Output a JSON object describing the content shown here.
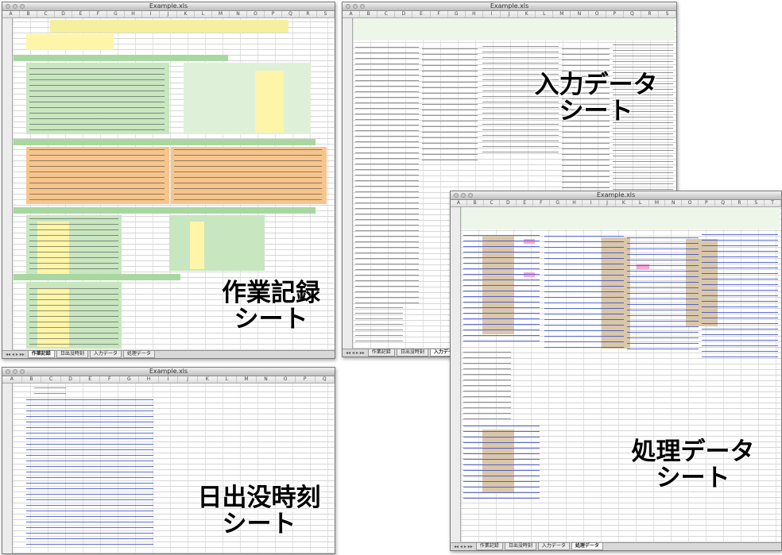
{
  "windows": {
    "w1": {
      "title": "Example.xls",
      "tabs": [
        "作業記録",
        "日出没時刻",
        "入力データ",
        "処理データ"
      ],
      "active_tab": 0
    },
    "w2": {
      "title": "Example.xls",
      "tabs": [
        "作業記録",
        "日出没時刻",
        "入力データ"
      ],
      "active_tab": 2
    },
    "w3": {
      "title": "Example.xls",
      "tabs": [
        "作業記録",
        "日出没時刻",
        "入力データ",
        "処理データ"
      ],
      "active_tab": 3
    },
    "w4": {
      "title": "Example.xls",
      "tabs": [],
      "active_tab": -1
    }
  },
  "captions": {
    "work_record": "作業記録\nシート",
    "input_data": "入力データ\nシート",
    "processed_data": "処理データ\nシート",
    "sunrise_sunset": "日出没時刻\nシート"
  },
  "colors": {
    "header_green": "#a8d8a0",
    "cell_yellow": "#fff5a8",
    "cell_orange": "#f6c58c",
    "highlight_pink": "#f5a8d8",
    "highlight_tan": "#d9c7a8",
    "text_blue": "#2a3cc8"
  }
}
